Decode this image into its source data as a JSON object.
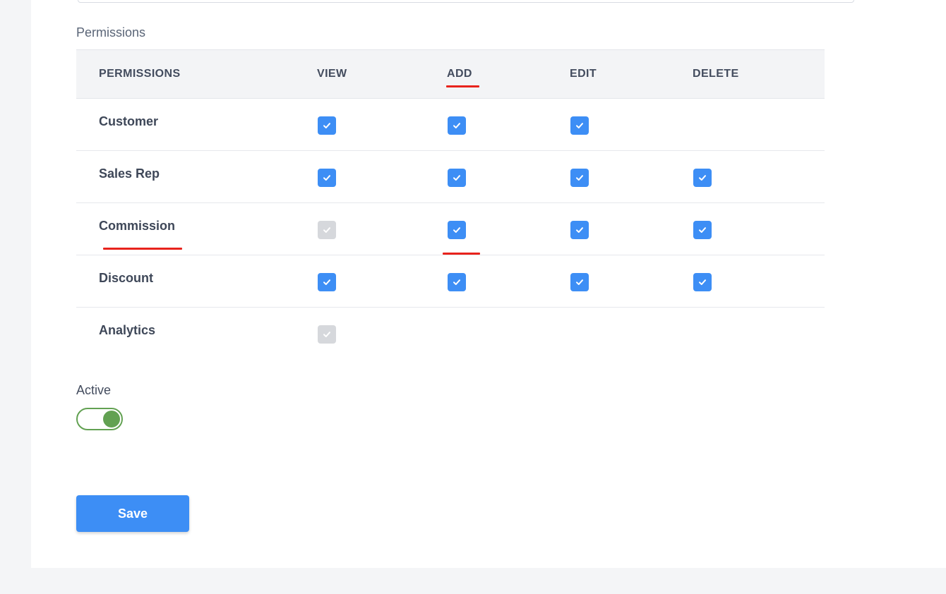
{
  "section_label": "Permissions",
  "columns": [
    "PERMISSIONS",
    "VIEW",
    "ADD",
    "EDIT",
    "DELETE"
  ],
  "rows": [
    {
      "label": "Customer",
      "view": "checked",
      "add": "checked",
      "edit": "checked",
      "delete": "none"
    },
    {
      "label": "Sales Rep",
      "view": "checked",
      "add": "checked",
      "edit": "checked",
      "delete": "checked"
    },
    {
      "label": "Commission",
      "view": "disabled",
      "add": "checked",
      "edit": "checked",
      "delete": "checked"
    },
    {
      "label": "Discount",
      "view": "checked",
      "add": "checked",
      "edit": "checked",
      "delete": "checked"
    },
    {
      "label": "Analytics",
      "view": "disabled",
      "add": "none",
      "edit": "none",
      "delete": "none"
    }
  ],
  "active": {
    "label": "Active",
    "value": true
  },
  "save_label": "Save",
  "colors": {
    "checkbox_checked": "#3d8ef5",
    "checkbox_disabled": "#d6d8dc",
    "toggle_on": "#62a152",
    "annotation_red": "#e8231c",
    "button_primary": "#3d8ef5"
  }
}
